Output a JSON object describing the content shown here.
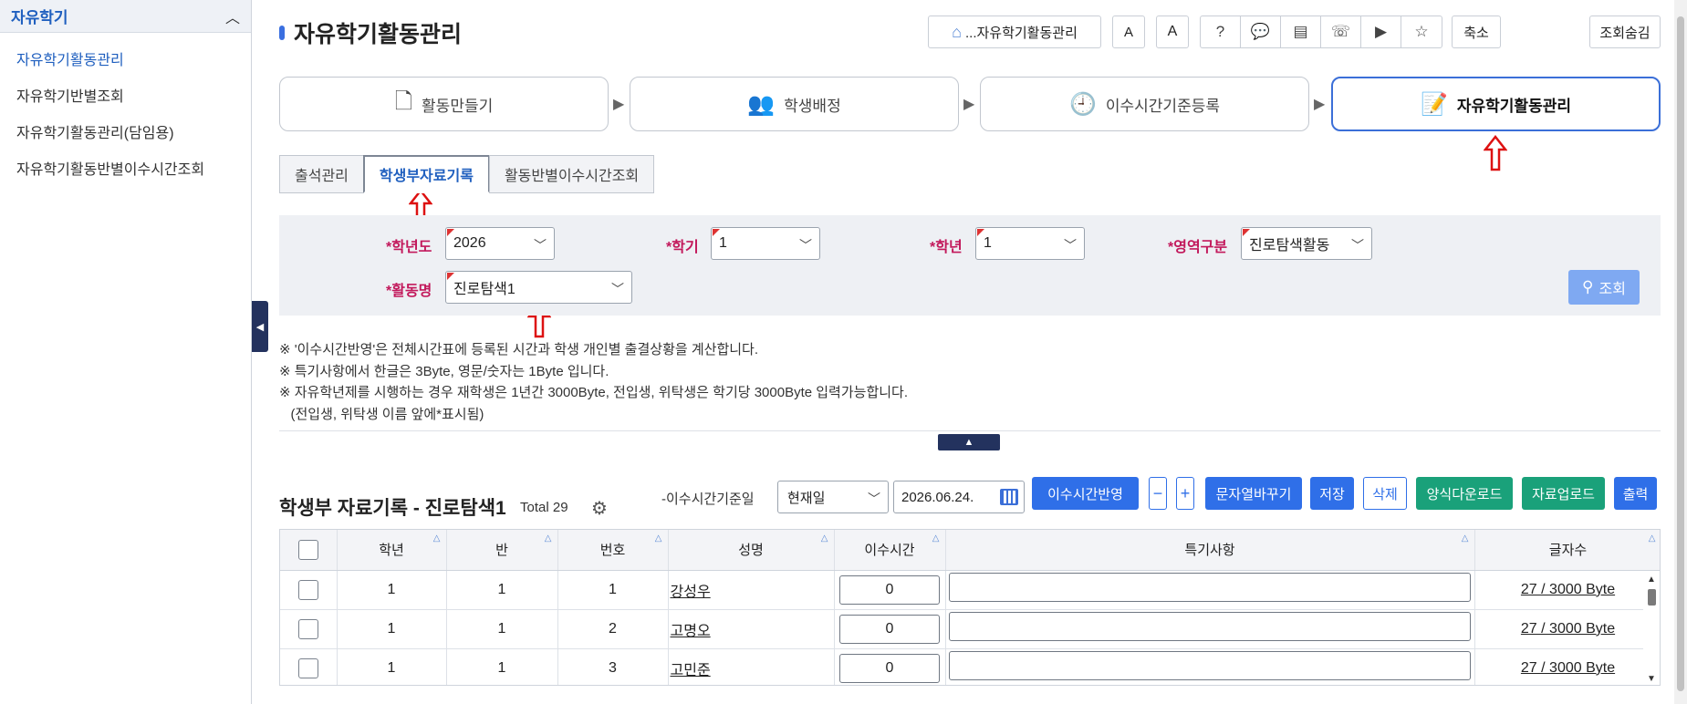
{
  "sidebar": {
    "title": "자유학기",
    "items": [
      {
        "label": "자유학기활동관리"
      },
      {
        "label": "자유학기반별조회"
      },
      {
        "label": "자유학기활동관리(담임용)"
      },
      {
        "label": "자유학기활동반별이수시간조회"
      }
    ]
  },
  "header": {
    "title": "자유학기활동관리",
    "home_label": "...자유학기활동관리",
    "font_small": "A",
    "font_large": "A",
    "shrink_label": "축소",
    "hide_search_label": "조회숨김"
  },
  "steps": [
    {
      "label": "활동만들기"
    },
    {
      "label": "학생배정"
    },
    {
      "label": "이수시간기준등록"
    },
    {
      "label": "자유학기활동관리"
    }
  ],
  "tabs": [
    {
      "label": "출석관리"
    },
    {
      "label": "학생부자료기록"
    },
    {
      "label": "활동반별이수시간조회"
    }
  ],
  "filter": {
    "year": {
      "label": "*학년도",
      "value": "2026"
    },
    "semester": {
      "label": "*학기",
      "value": "1"
    },
    "grade": {
      "label": "*학년",
      "value": "1"
    },
    "area": {
      "label": "*영역구분",
      "value": "진로탐색활동"
    },
    "activity": {
      "label": "*활동명",
      "value": "진로탐색1"
    },
    "search_label": "조회"
  },
  "notes": [
    "※ '이수시간반영'은 전체시간표에 등록된 시간과 학생 개인별 출결상황을 계산합니다.",
    "※ 특기사항에서 한글은 3Byte, 영문/숫자는 1Byte 입니다.",
    "※ 자유학년제를 시행하는 경우 재학생은 1년간 3000Byte, 전입생, 위탁생은 학기당 3000Byte 입력가능합니다.",
    "   (전입생, 위탁생 이름 앞에*표시됨)"
  ],
  "section": {
    "title": "학생부 자료기록 - 진로탐색1",
    "total": "Total 29",
    "basis_label": "-이수시간기준일",
    "basis_value": "현재일",
    "date_value": "2026.06.24.",
    "btn_apply": "이수시간반영",
    "btn_minus": "−",
    "btn_plus": "+",
    "btn_swap": "문자열바꾸기",
    "btn_save": "저장",
    "btn_delete": "삭제",
    "btn_template": "양식다운로드",
    "btn_upload": "자료업로드",
    "btn_print": "출력"
  },
  "table": {
    "columns": [
      "학년",
      "반",
      "번호",
      "성명",
      "이수시간",
      "특기사항",
      "글자수"
    ],
    "rows": [
      {
        "grade": "1",
        "class": "1",
        "num": "1",
        "name": "강성우",
        "hours": "0",
        "bytes": "27 / 3000 Byte"
      },
      {
        "grade": "1",
        "class": "1",
        "num": "2",
        "name": "고명오",
        "hours": "0",
        "bytes": "27 / 3000 Byte"
      },
      {
        "grade": "1",
        "class": "1",
        "num": "3",
        "name": "고민준",
        "hours": "0",
        "bytes": "27 / 3000 Byte"
      }
    ]
  },
  "colors": {
    "accent": "#2f6fe8",
    "green": "#1aa17a",
    "required_label": "#c2185b",
    "marker_red": "#d11"
  }
}
